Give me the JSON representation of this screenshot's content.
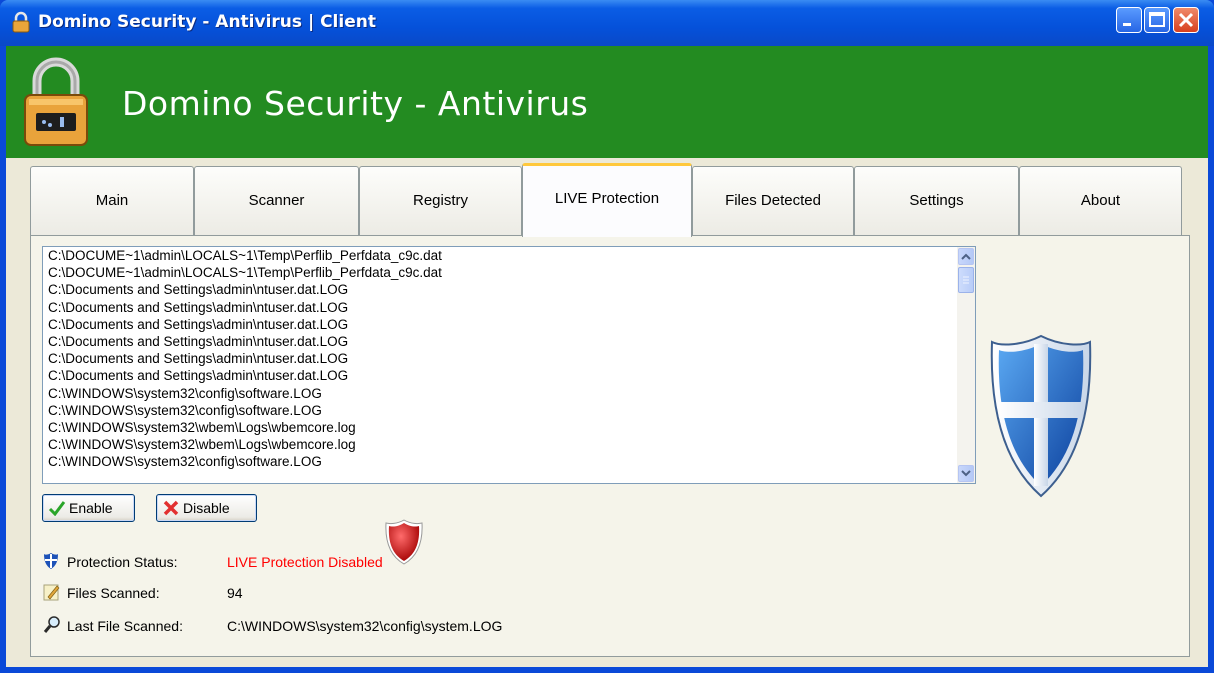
{
  "window": {
    "title": "Domino Security - Antivirus | Client"
  },
  "header": {
    "app_title": "Domino Security - Antivirus"
  },
  "tabs": [
    {
      "label": "Main"
    },
    {
      "label": "Scanner"
    },
    {
      "label": "Registry"
    },
    {
      "label": "LIVE Protection",
      "active": true
    },
    {
      "label": "Files Detected"
    },
    {
      "label": "Settings"
    },
    {
      "label": "About"
    }
  ],
  "log": [
    "C:\\DOCUME~1\\admin\\LOCALS~1\\Temp\\Perflib_Perfdata_c9c.dat",
    "C:\\DOCUME~1\\admin\\LOCALS~1\\Temp\\Perflib_Perfdata_c9c.dat",
    "C:\\Documents and Settings\\admin\\ntuser.dat.LOG",
    "C:\\Documents and Settings\\admin\\ntuser.dat.LOG",
    "C:\\Documents and Settings\\admin\\ntuser.dat.LOG",
    "C:\\Documents and Settings\\admin\\ntuser.dat.LOG",
    "C:\\Documents and Settings\\admin\\ntuser.dat.LOG",
    "C:\\Documents and Settings\\admin\\ntuser.dat.LOG",
    "C:\\WINDOWS\\system32\\config\\software.LOG",
    "C:\\WINDOWS\\system32\\config\\software.LOG",
    "C:\\WINDOWS\\system32\\wbem\\Logs\\wbemcore.log",
    "C:\\WINDOWS\\system32\\wbem\\Logs\\wbemcore.log",
    "C:\\WINDOWS\\system32\\config\\software.LOG"
  ],
  "buttons": {
    "enable": "Enable",
    "disable": "Disable"
  },
  "status": {
    "protection_label": "Protection Status:",
    "protection_value": "LIVE Protection Disabled",
    "files_label": "Files Scanned:",
    "files_value": "94",
    "last_label": "Last File Scanned:",
    "last_value": "C:\\WINDOWS\\system32\\config\\system.LOG"
  },
  "colors": {
    "header_green": "#238b21",
    "status_red": "#ff0000",
    "titlebar_blue": "#0551da"
  },
  "icons": [
    "padlock-icon",
    "minimize-icon",
    "maximize-icon",
    "close-icon",
    "checkmark-icon",
    "x-icon",
    "shield-icon",
    "notepad-icon",
    "magnifier-icon"
  ]
}
